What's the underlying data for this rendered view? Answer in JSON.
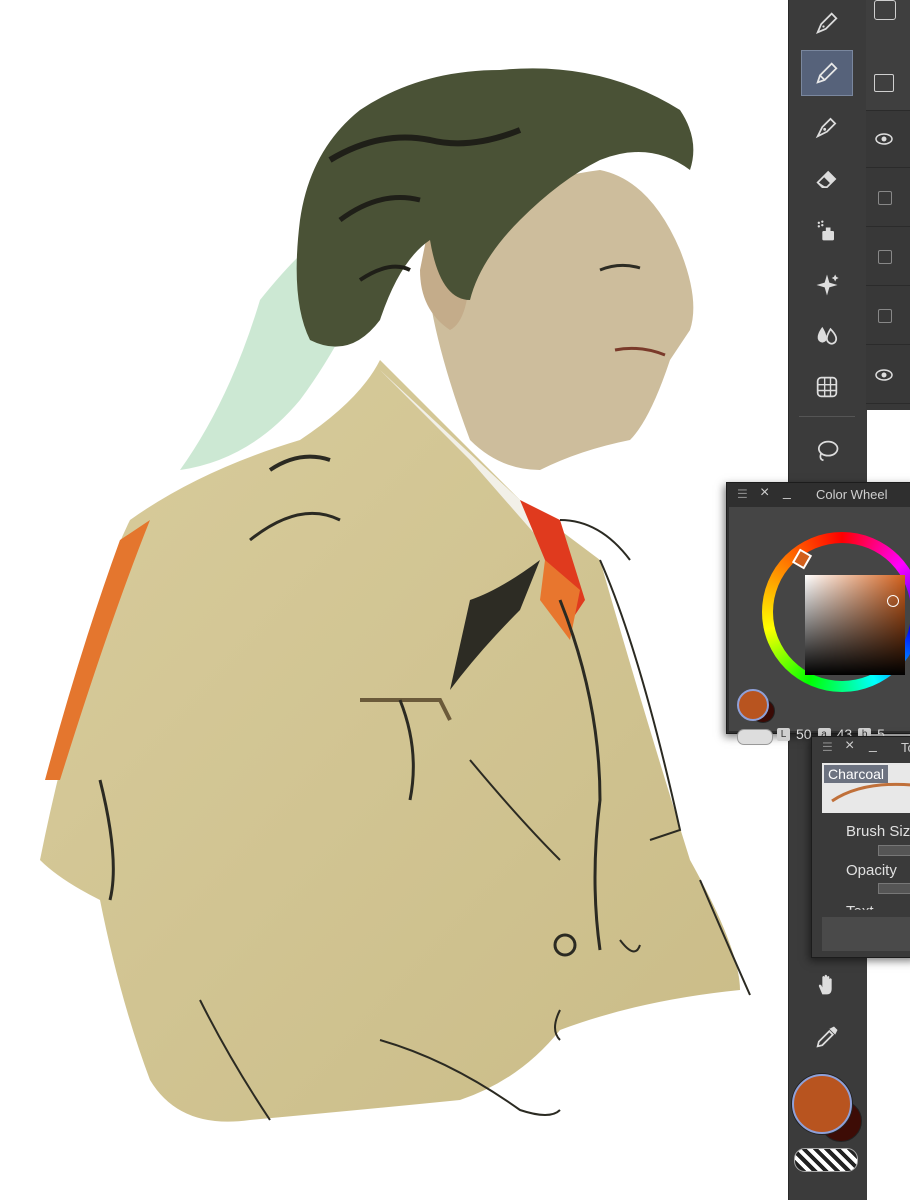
{
  "toolbar": {
    "tools": [
      "pen-tool-icon",
      "pencil-tool-icon",
      "ink-pen-icon",
      "eraser-icon",
      "airbrush-icon",
      "sparkle-icon",
      "blend-icon",
      "grid-icon",
      "lasso-icon",
      "hand-icon",
      "eyedropper-icon"
    ],
    "active_tool": "pencil-tool-icon"
  },
  "color_wheel_panel": {
    "title": "Color Wheel",
    "values": {
      "L": "50",
      "a": "43",
      "b": "5"
    },
    "labels": {
      "L": "L",
      "a": "a",
      "b": "b"
    },
    "main_color": "#b8541f",
    "sub_color": "#3a0a05"
  },
  "brush_panel": {
    "title_partial": "To",
    "brush_name": "Charcoal",
    "settings": [
      "Brush Siz",
      "Opacity",
      "Text"
    ]
  },
  "colors": {
    "main": "#b8541f",
    "sub": "#3d0c06",
    "panel_bg": "#454545",
    "toolbar_bg": "#3b3b3b"
  }
}
